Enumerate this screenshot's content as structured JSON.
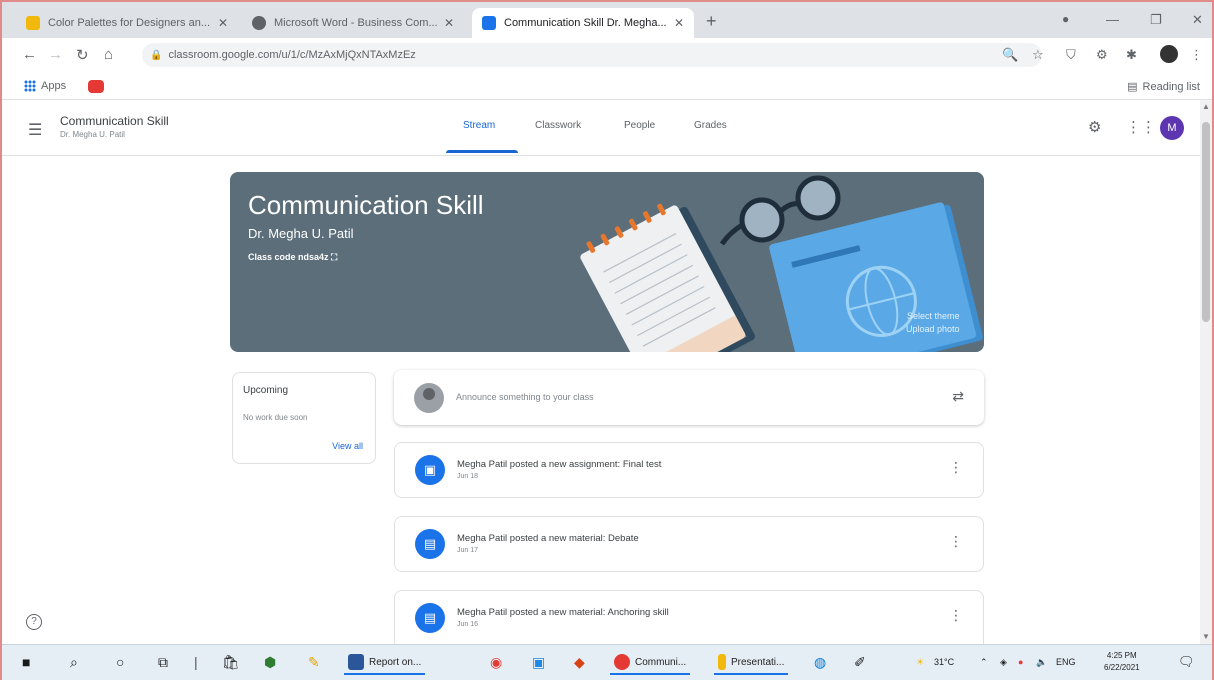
{
  "browser": {
    "tabs": [
      {
        "title": "Color Palettes for Designers an...",
        "fav_color": "#f2b90c",
        "active": false
      },
      {
        "title": "Microsoft Word - Business Com...",
        "fav_color": "#5f6368",
        "active": false
      },
      {
        "title": "Communication Skill Dr. Megha...",
        "fav_color": "#1a73e8",
        "active": true
      }
    ],
    "url": "classroom.google.com/u/1/c/MzAxMjQxNTAxMzEz",
    "bookmarks": {
      "apps_label": "Apps",
      "reading_list_label": "Reading list"
    }
  },
  "classroom": {
    "class_name": "Communication Skill",
    "class_subtitle": "Dr. Megha U. Patil",
    "nav": {
      "stream": "Stream",
      "classwork": "Classwork",
      "people": "People",
      "grades": "Grades"
    },
    "avatar_letter": "M"
  },
  "banner": {
    "title": "Communication Skill",
    "teacher": "Dr. Megha U. Patil",
    "class_code": "Class code  ndsa4z ⛶",
    "select_theme": "Select theme",
    "upload_photo": "Upload photo"
  },
  "upcoming": {
    "title": "Upcoming",
    "empty": "No work due soon",
    "view_all": "View all"
  },
  "announce": {
    "placeholder": "Announce something to your class"
  },
  "posts": [
    {
      "title": "Megha Patil posted a new assignment: Final test",
      "date": "Jun 18"
    },
    {
      "title": "Megha Patil posted a new material: Debate",
      "date": "Jun 17"
    },
    {
      "title": "Megha Patil posted a new material: Anchoring skill",
      "date": "Jun 16"
    }
  ],
  "taskbar": {
    "word_label": "Report on...",
    "chrome_label": "Communi...",
    "ppt_label": "Presentati...",
    "temperature": "31°C",
    "lang": "ENG",
    "time": "4:25 PM",
    "date": "6/22/2021"
  }
}
